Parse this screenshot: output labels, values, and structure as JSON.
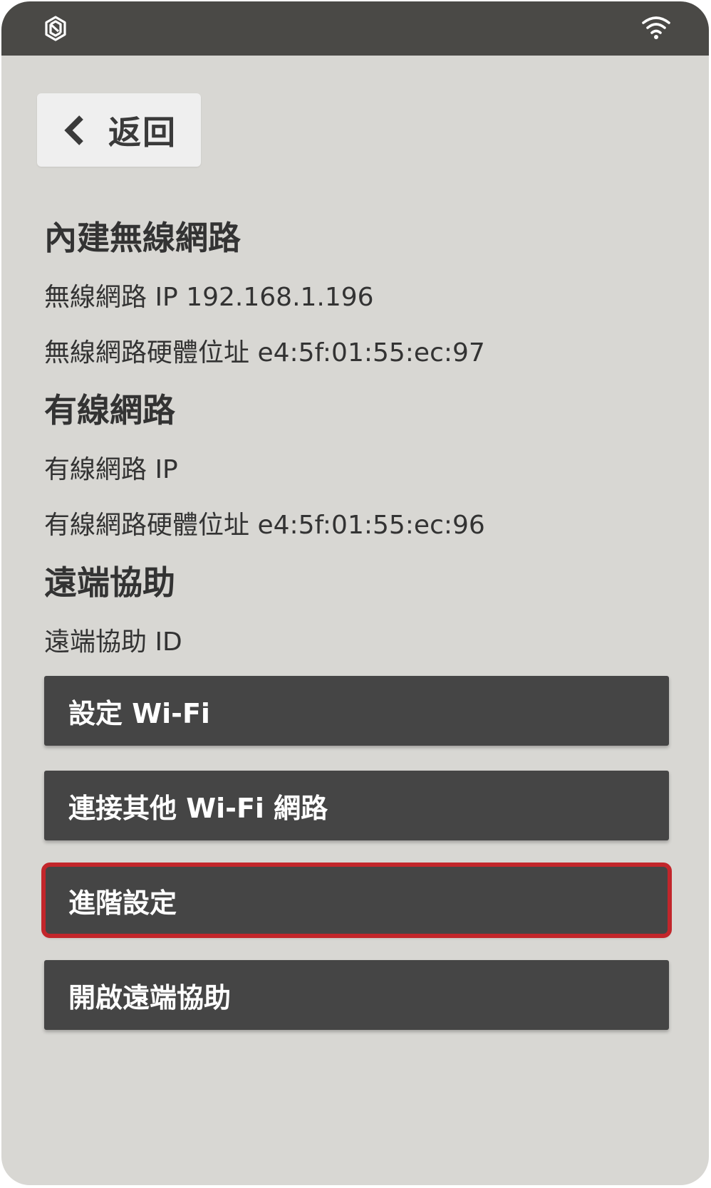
{
  "statusbar": {
    "logo_icon": "app-logo-icon",
    "wifi_icon": "wifi-icon"
  },
  "back": {
    "label": "返回"
  },
  "sections": {
    "wireless": {
      "title": "內建無線網路",
      "ip": "無線網路 IP 192.168.1.196",
      "mac": "無線網路硬體位址 e4:5f:01:55:ec:97"
    },
    "wired": {
      "title": "有線網路",
      "ip": "有線網路 IP",
      "mac": "有線網路硬體位址 e4:5f:01:55:ec:96"
    },
    "remote": {
      "title": "遠端協助",
      "id": "遠端協助 ID"
    }
  },
  "actions": {
    "setup_wifi": "設定 Wi-Fi",
    "connect_other": "連接其他 Wi-Fi 網路",
    "advanced": "進階設定",
    "enable_remote": "開啟遠端協助"
  },
  "colors": {
    "statusbar": "#4a4946",
    "background": "#d8d7d3",
    "button": "#454545",
    "highlight": "#c2262b"
  }
}
